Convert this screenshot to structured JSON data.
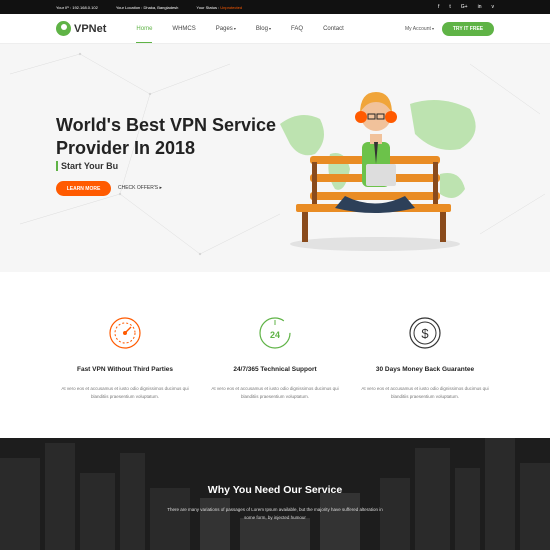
{
  "topbar": {
    "ip_label": "Your IP : 192.168.0.102",
    "location_label": "Your Location : Dhaka, Bangladesh",
    "status_label": "Your Status : ",
    "status_value": "Unprotected",
    "social": [
      "f",
      "t",
      "G+",
      "in",
      "v"
    ]
  },
  "nav": {
    "logo": "VPNet",
    "menu": [
      "Home",
      "WHMCS",
      "Pages",
      "Blog",
      "FAQ",
      "Contact"
    ],
    "account": "My Account",
    "cta": "TRY IT FREE"
  },
  "hero": {
    "title": "World's Best VPN Service Provider In 2018",
    "subtitle": "Start Your Bu",
    "learn_more": "LEARN MORE",
    "check_offers": "CHECK OFFER'S"
  },
  "features": [
    {
      "title": "Fast VPN Without Third Parties",
      "text": "At vero eos et accusamus et iusto odio dignissimos ducimus qui blanditiis praesentium voluptatum.",
      "icon": "speedometer-icon"
    },
    {
      "title": "24/7/365 Technical Support",
      "text": "At vero eos et accusamus et iusto odio dignissimos ducimus qui blanditiis praesentium voluptatum.",
      "icon": "clock-24-icon"
    },
    {
      "title": "30 Days Money Back Guarantee",
      "text": "At vero eos et accusamus et iusto odio dignissimos ducimus qui blanditiis praesentium voluptatum.",
      "icon": "dollar-coin-icon"
    }
  ],
  "why": {
    "title": "Why You Need Our Service",
    "text": "There are many variations of passages of Lorem Ipsum available, but the majority have suffered alteration in some form, by injected humour"
  },
  "colors": {
    "accent": "#5fb346",
    "orange": "#ff5a00"
  }
}
